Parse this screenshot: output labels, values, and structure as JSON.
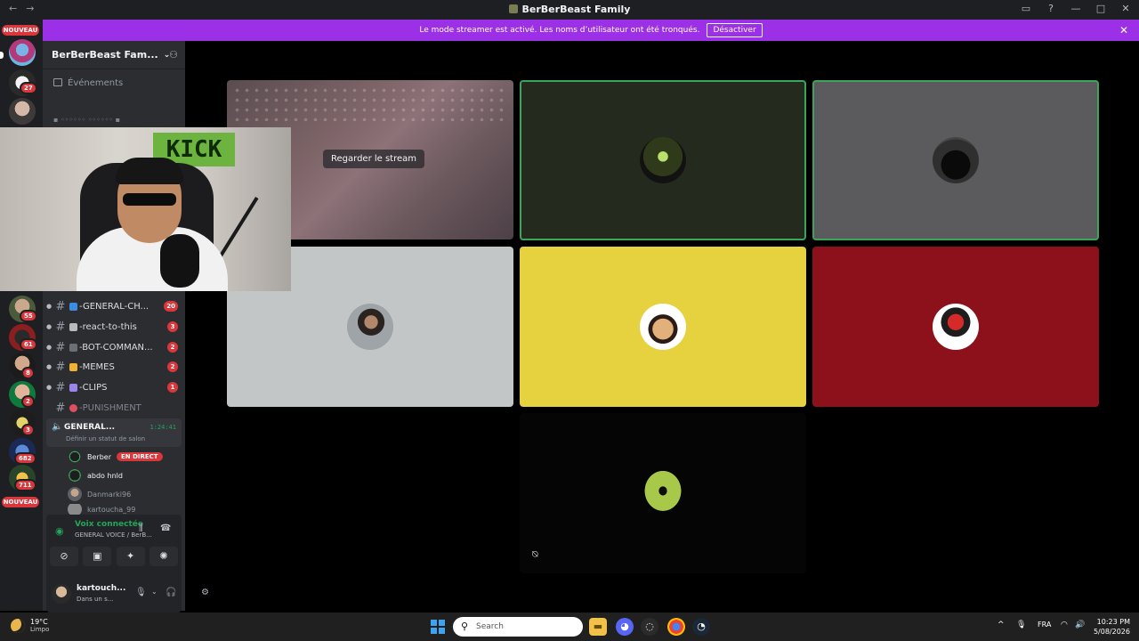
{
  "titlebar": {
    "title": "BerBerBeast Family",
    "back": "←",
    "forward": "→"
  },
  "banner": {
    "message": "Le mode streamer est activé. Les noms d’utilisateur ont été tronqués.",
    "button": "Désactiver"
  },
  "servers": {
    "nouveau_top": "NOUVEAU",
    "nouveau_bottom": "NOUVEAU",
    "badges": [
      "27",
      "55",
      "61",
      "8",
      "2",
      "3",
      "682",
      "711"
    ]
  },
  "sidebar": {
    "guild_name": "BerBerBeast Fam...",
    "events": "Événements",
    "channels": [
      {
        "name": "-GENERAL-CH...",
        "count": "20",
        "emoji_color": "#3c8de0"
      },
      {
        "name": "-react-to-this",
        "count": "3",
        "emoji_color": "#b9bbbe"
      },
      {
        "name": "-BOT-COMMAN...",
        "count": "2",
        "emoji_color": "#6b6f76"
      },
      {
        "name": "-MEMES",
        "count": "2",
        "emoji_color": "#f0b232"
      },
      {
        "name": "-CLIPS",
        "count": "1",
        "emoji_color": "#9b84ec"
      },
      {
        "name": "-PUNISHMENT",
        "count": "",
        "emoji_color": "#e04f5f"
      }
    ],
    "voice_channel": {
      "name": "GENERAL...",
      "timer": "1:24:41",
      "status": "Définir un statut de salon"
    },
    "members": [
      {
        "name": "Berber",
        "live": "EN DIRECT"
      },
      {
        "name": "abdo hnld"
      },
      {
        "name": "Danmarki96"
      },
      {
        "name": "kartoucha_99"
      }
    ],
    "voice_panel": {
      "title": "Voix connectée",
      "subtitle": "GENERAL VOICE / BerB..."
    },
    "user": {
      "name": "kartouch...",
      "status": "Dans un s..."
    }
  },
  "stage": {
    "watch_stream": "Regarder le stream",
    "tiles": [
      {
        "id": "stream"
      },
      {
        "id": "berberbeast",
        "bg": "#252a1e",
        "speaking": true
      },
      {
        "id": "hooded",
        "bg": "#5b5b5d",
        "speaking": true
      },
      {
        "id": "photo",
        "bg": "#c3c6c6"
      },
      {
        "id": "cartoon-face",
        "bg": "#e6d23f"
      },
      {
        "id": "red-figure",
        "bg": "#8c111b"
      },
      {
        "id": "alien",
        "bg": "#050505"
      }
    ]
  },
  "taskbar": {
    "temp": "19°C",
    "weather": "Limpo",
    "search": "Search",
    "lang": "FRA",
    "time": "10:23 PM",
    "date": "5/08/2026"
  }
}
